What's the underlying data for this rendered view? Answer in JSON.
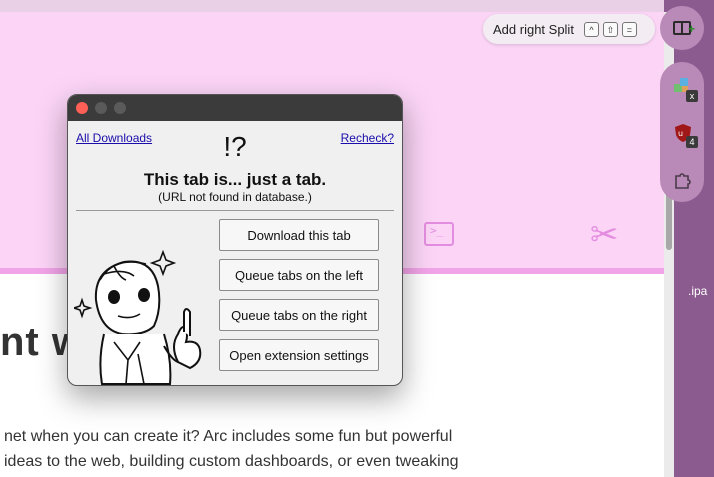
{
  "browser": {
    "split_tooltip": {
      "label": "Add right Split",
      "keys": [
        "^",
        "⇧",
        "="
      ]
    },
    "right_sidebar": {
      "side_label": ".ipa",
      "extensions": [
        {
          "icon": "puzzle-color-icon",
          "badge": "x"
        },
        {
          "icon": "ublock-icon",
          "badge": "4"
        },
        {
          "icon": "extensions-puzzle-icon",
          "badge": ""
        }
      ]
    }
  },
  "background_page": {
    "heading_fragment": "nt w",
    "body_lines": [
      "net when you can create it? Arc includes some fun but powerful",
      "ideas to the web, building custom dashboards, or even tweaking"
    ],
    "terminal_glyph": ">_",
    "scissors_glyph": "✂"
  },
  "popup": {
    "links": {
      "all_downloads": "All Downloads",
      "recheck": "Recheck?"
    },
    "symbol": "!?",
    "title": "This tab is... just a tab.",
    "subtitle": "(URL not found in database.)",
    "buttons": [
      "Download this tab",
      "Queue tabs on the left",
      "Queue tabs on the right",
      "Open extension settings"
    ]
  },
  "colors": {
    "page_pink": "#fbd4f6",
    "accent_pink": "#e48de0",
    "sidebar_purple": "#b98ab8",
    "titlebar": "#3b3b3b"
  }
}
